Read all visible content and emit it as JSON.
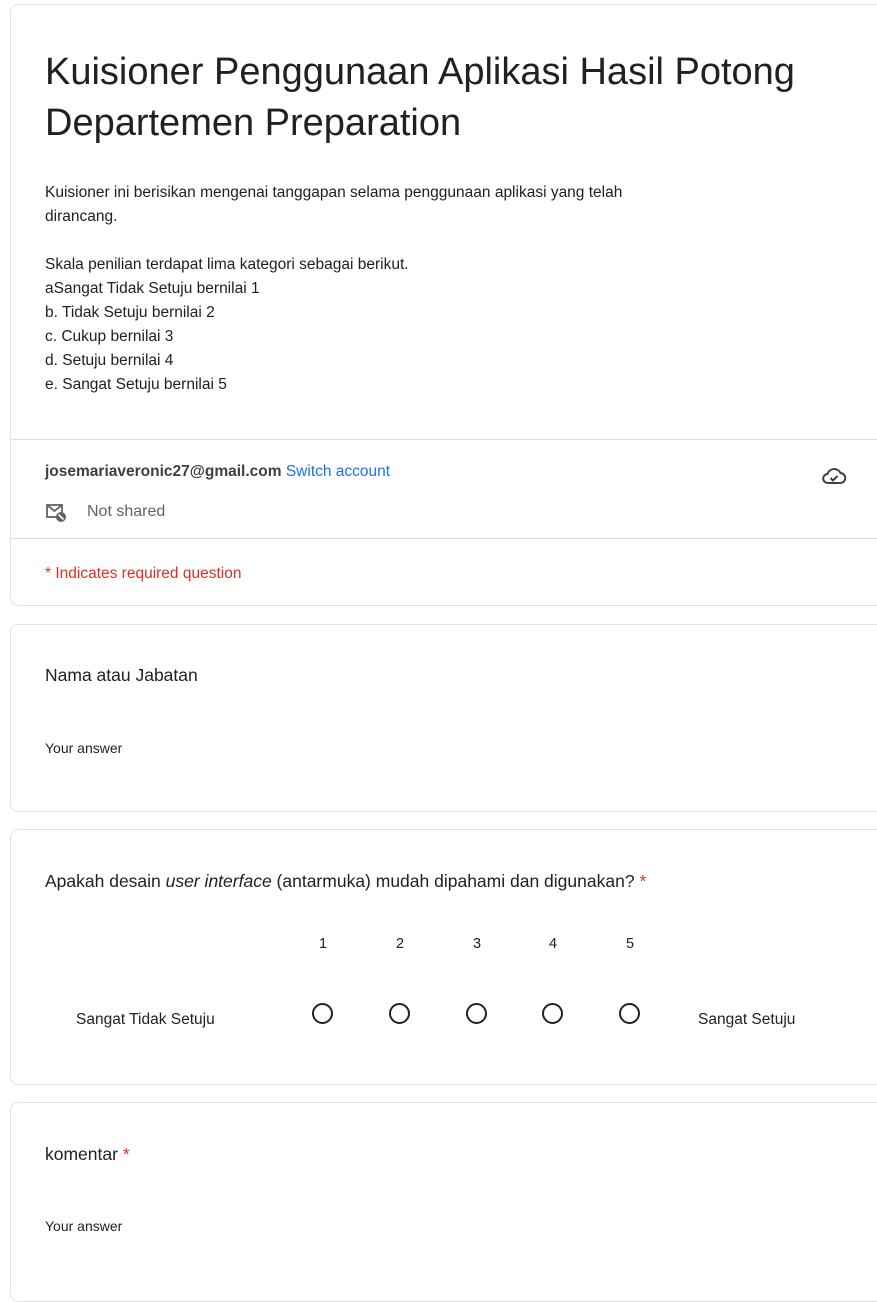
{
  "form": {
    "title": "Kuisioner Penggunaan Aplikasi Hasil Potong Departemen Preparation",
    "description_lines": [
      "Kuisioner ini berisikan mengenai tanggapan selama penggunaan aplikasi yang telah",
      "dirancang.",
      "",
      "Skala penilian terdapat lima kategori sebagai berikut.",
      "aSangat Tidak Setuju bernilai 1",
      "b. Tidak Setuju bernilai 2",
      "c. Cukup bernilai 3",
      "d. Setuju bernilai 4",
      "e. Sangat Setuju bernilai 5"
    ],
    "account": {
      "email": "josemariaveronic27@gmail.com",
      "switch_label": "Switch account",
      "not_shared": "Not shared"
    },
    "required_note": "* Indicates required question",
    "icons": {
      "cloud": "cloud-check-icon",
      "not_shared": "mail-off-icon"
    }
  },
  "questions": [
    {
      "label": "Nama atau Jabatan",
      "required": false,
      "placeholder": "Your answer"
    },
    {
      "label_before": "Apakah desain ",
      "label_italic": "user interface",
      "label_after": " (antarmuka) mudah dipahami dan digunakan?",
      "required": true,
      "required_mark": "*",
      "scale": {
        "values": [
          "1",
          "2",
          "3",
          "4",
          "5"
        ],
        "min_label": "Sangat Tidak Setuju",
        "max_label": "Sangat Setuju",
        "selected": null
      }
    },
    {
      "label": "komentar",
      "required": true,
      "required_mark": "*",
      "placeholder": "Your answer"
    }
  ],
  "colors": {
    "accent_link": "#1a73e8",
    "required_red": "#d93025",
    "text": "#202124",
    "border": "#dadce0"
  }
}
